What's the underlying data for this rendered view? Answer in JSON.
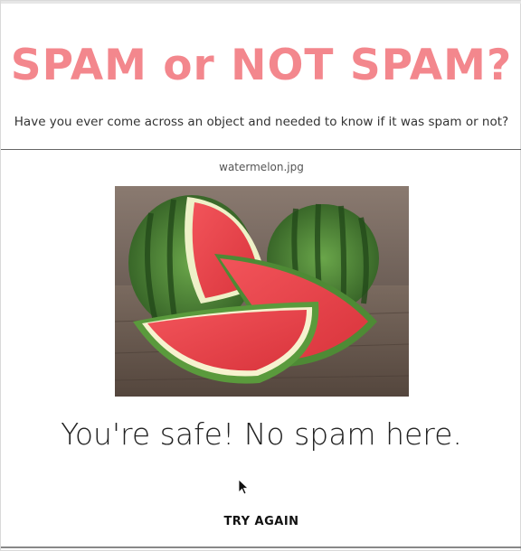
{
  "header": {
    "title": "SPAM or NOT SPAM?",
    "subtitle": "Have you ever come across an object and needed to know if it was spam or not?"
  },
  "upload": {
    "filename": "watermelon.jpg"
  },
  "result": {
    "message": "You're safe! No spam here."
  },
  "actions": {
    "try_again_label": "TRY AGAIN"
  },
  "colors": {
    "title": "#f3878d",
    "divider": "#666666"
  },
  "icons": {
    "cursor": "mouse-pointer-icon"
  }
}
